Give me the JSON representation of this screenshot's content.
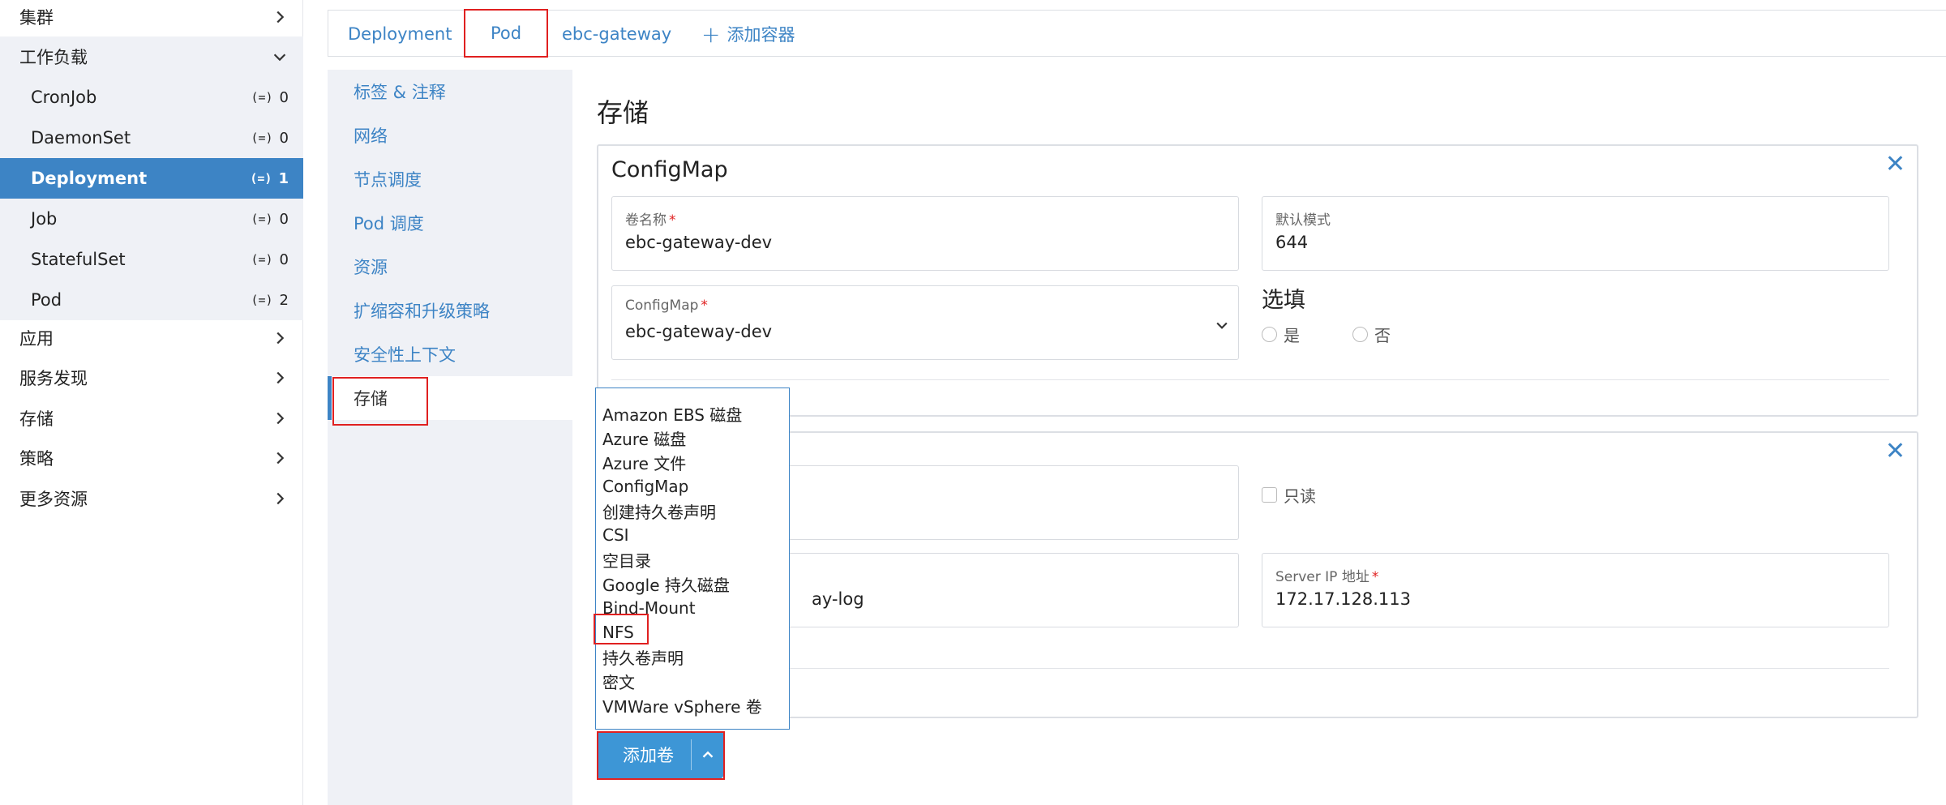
{
  "leftnav": {
    "cluster": "集群",
    "workload": "工作负载",
    "items": [
      {
        "label": "CronJob",
        "count": "0"
      },
      {
        "label": "DaemonSet",
        "count": "0"
      },
      {
        "label": "Deployment",
        "count": "1"
      },
      {
        "label": "Job",
        "count": "0"
      },
      {
        "label": "StatefulSet",
        "count": "0"
      },
      {
        "label": "Pod",
        "count": "2"
      }
    ],
    "count_icon": "(=)",
    "apps": "应用",
    "service_discovery": "服务发现",
    "storage": "存储",
    "policy": "策略",
    "more": "更多资源"
  },
  "tabs": {
    "deployment": "Deployment",
    "pod": "Pod",
    "container": "ebc-gateway",
    "add_container": "添加容器"
  },
  "sections": {
    "labels": "标签 & 注释",
    "network": "网络",
    "node_scheduling": "节点调度",
    "pod_scheduling": "Pod 调度",
    "resources": "资源",
    "scaling": "扩缩容和升级策略",
    "security": "安全性上下文",
    "storage": "存储"
  },
  "main": {
    "heading": "存储",
    "configmap_card": {
      "title": "ConfigMap",
      "volume_name_label": "卷名称",
      "volume_name_value": "ebc-gateway-dev",
      "default_mode_label": "默认模式",
      "default_mode_value": "644",
      "configmap_label": "ConfigMap",
      "configmap_value": "ebc-gateway-dev",
      "optional_title": "选填",
      "yes": "是",
      "no": "否"
    },
    "nfs_card": {
      "readonly_label": "只读",
      "path_value_fragment": "ay-log",
      "server_ip_label": "Server IP 地址",
      "server_ip_value": "172.17.128.113"
    }
  },
  "dropdown": {
    "options": [
      "Amazon EBS 磁盘",
      "Azure 磁盘",
      "Azure 文件",
      "ConfigMap",
      "创建持久卷声明",
      "CSI",
      "空目录",
      "Google 持久磁盘",
      "Bind-Mount",
      "NFS",
      "持久卷声明",
      "密文",
      "VMWare vSphere 卷"
    ]
  },
  "add_volume_button": "添加卷",
  "colors": {
    "accent": "#3d84c5",
    "button": "#3d96d6",
    "highlight": "#e02020",
    "sidebar_bg": "#eff1f6"
  }
}
